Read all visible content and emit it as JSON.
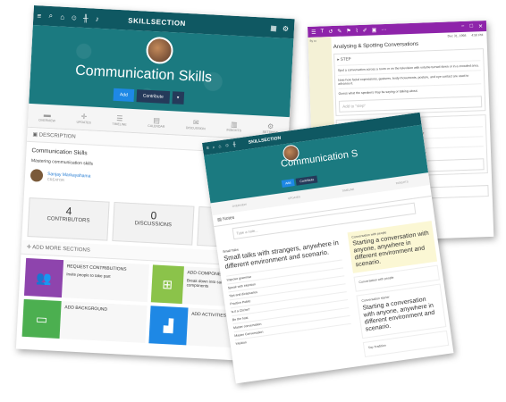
{
  "skill_page": {
    "app_title": "SKILLSECTION",
    "skill_title": "Communication Skills",
    "buttons": {
      "add": "Add",
      "contribute": "Contribute",
      "more": "▾"
    },
    "tabs": [
      "OVERVIEW",
      "UPDATES",
      "TIMELINE",
      "CALENDAR",
      "DISCUSSION",
      "INSIGHTS",
      "SETTINGS"
    ],
    "description_header": "DESCRIPTION",
    "description_title": "Communication Skills",
    "description_text": "Mastering communication skills",
    "creator_name": "Sanjay Markayahama",
    "creator_role": "CREATOR",
    "stats": [
      {
        "num": "4",
        "label": "CONTRIBUTORS"
      },
      {
        "num": "0",
        "label": "DISCUSSIONS"
      },
      {
        "num": "1",
        "label": "ACTIVI"
      }
    ],
    "more_sections_header": "ADD MORE SECTIONS",
    "tiles": [
      {
        "title": "REQUEST CONTRIBUTIONS",
        "text": "Invite people to take part",
        "color": "#8e44ad",
        "icon": "users-icon"
      },
      {
        "title": "ADD COMPONENTS",
        "text": "Break down into subcomponents and related components",
        "color": "#8bc34a",
        "icon": "hierarchy-icon"
      },
      {
        "title": "ADD BACKGROUND",
        "text": "",
        "color": "#4caf50",
        "icon": "image-icon"
      },
      {
        "title": "ADD ACTIVITIES",
        "text": "",
        "color": "#1e88e5",
        "icon": "activity-icon"
      }
    ]
  },
  "notes_page": {
    "app_title": "SKILLSECTION",
    "skill_title": "Communication S",
    "buttons": {
      "add": "Add",
      "contribute": "Contribute"
    },
    "tabs": [
      "OVERVIEW",
      "UPDATES",
      "TIMELINE",
      "INSIGHTS"
    ],
    "notes_header": "Notes",
    "input_placeholder": "Type a note...",
    "left_small_label": "Small Talks",
    "left_big_note": "Small talks with strangers, anywhere in different environment and scenario.",
    "left_list": [
      "Improve grammar",
      "Speak with intention",
      "Tips and dictionaries",
      "Practice Public",
      "Is it a Cliche?",
      "Be the host",
      "Master conversation",
      "Master Conversation",
      "Intuition"
    ],
    "right_notes": [
      {
        "header": "Conversation with people",
        "body": "Starting a conversation with anyone, anywhere in different environment and scenario.",
        "style": "yellow"
      },
      {
        "header": "Conversation with people",
        "body": "",
        "style": "white"
      },
      {
        "header": "Conversation starter",
        "body": "Starting a conversation with anyone, anywhere in different environment and scenario.",
        "style": "white"
      },
      {
        "header": "Top Tradition",
        "body": "",
        "style": "white"
      }
    ]
  },
  "analysis_page": {
    "date": "Dec 31, 1998",
    "time": "4:50 PM",
    "title": "Analysing & Spotting Conversations",
    "side_text": "By co",
    "step_header": "STEP",
    "step_rows": [
      "Spot a conversation across a room or on the television with volume turned down or in a crowded area.",
      "Note how facial expressions, gestures, body movements, posture, and eye contact are used to advance it.",
      "Guess what the speakers may be saying or talking about."
    ],
    "step_input": "Add to \"step\"",
    "question_header": "QUESTION",
    "question_rows": [
      "Which nonverbal cues suggest the nature of a conversation?",
      "What language are the participants speaking?",
      "How do you tell what language the participants are speaking?"
    ],
    "question_input": "Add to \"question\"",
    "comments_label": "Comments",
    "comment_placeholder": "Write a comment",
    "accent_color": "#8e24aa"
  }
}
